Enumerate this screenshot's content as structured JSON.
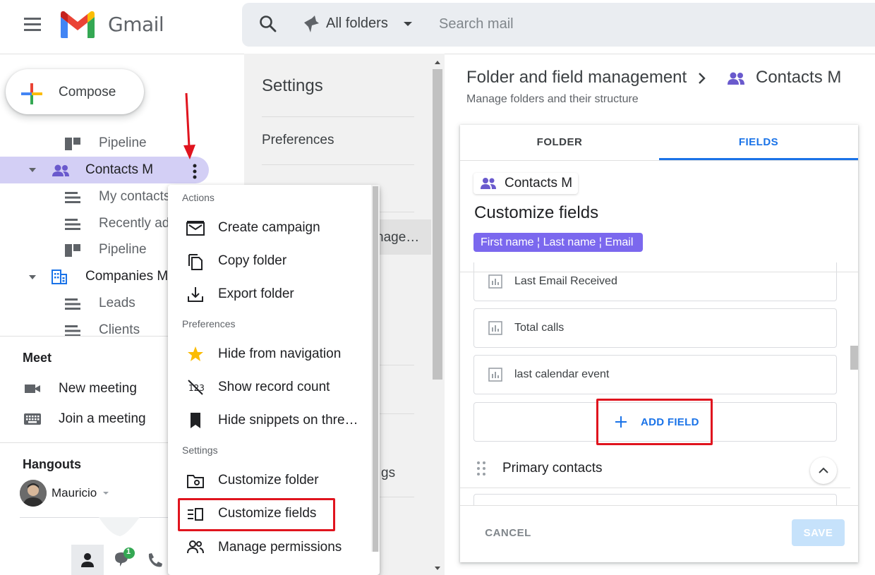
{
  "app": {
    "name": "Gmail"
  },
  "search": {
    "folder_label": "All folders",
    "placeholder": "Search mail"
  },
  "compose": {
    "label": "Compose"
  },
  "sidebar": {
    "items": [
      {
        "label": "Pipeline",
        "icon": "board-icon"
      },
      {
        "label": "Contacts M",
        "icon": "contacts-icon",
        "selected": true
      },
      {
        "label": "My contacts",
        "icon": "list-icon"
      },
      {
        "label": "Recently added",
        "icon": "list-icon"
      },
      {
        "label": "Pipeline",
        "icon": "board-icon"
      },
      {
        "label": "Companies M",
        "icon": "building-icon"
      },
      {
        "label": "Leads",
        "icon": "list-icon"
      },
      {
        "label": "Clients",
        "icon": "list-icon"
      }
    ]
  },
  "meet": {
    "title": "Meet",
    "new_meeting": "New meeting",
    "join_meeting": "Join a meeting"
  },
  "hangouts": {
    "title": "Hangouts",
    "user": "Mauricio",
    "notification_count": "1"
  },
  "settings": {
    "title": "Settings",
    "preferences": "Preferences",
    "clipped_item": "nage…",
    "clipped_item2": "gs"
  },
  "context_menu": {
    "sections": [
      {
        "heading": "Actions",
        "items": [
          "Create campaign",
          "Copy folder",
          "Export folder"
        ]
      },
      {
        "heading": "Preferences",
        "items": [
          "Hide from navigation",
          "Show record count",
          "Hide snippets on thre…"
        ]
      },
      {
        "heading": "Settings",
        "items": [
          "Customize folder",
          "Customize fields",
          "Manage permissions"
        ]
      }
    ]
  },
  "panel": {
    "title": "Folder and field management",
    "breadcrumb_current": "Contacts M",
    "subtitle": "Manage folders and their structure",
    "tabs": [
      "FOLDER",
      "FIELDS"
    ],
    "active_tab": "FIELDS",
    "chip_label": "Contacts M",
    "section_title": "Customize fields",
    "name_tag": "First name ¦ Last name ¦ Email",
    "fields": [
      "Last Email Received",
      "Total calls",
      "last calendar event"
    ],
    "add_field": "ADD FIELD",
    "group_label": "Primary contacts",
    "cancel": "CANCEL",
    "save": "SAVE"
  },
  "colors": {
    "accent": "#1a73e8",
    "selected_nav": "#d3cff5",
    "tag": "#7b68ee",
    "highlight": "#e0141e"
  }
}
